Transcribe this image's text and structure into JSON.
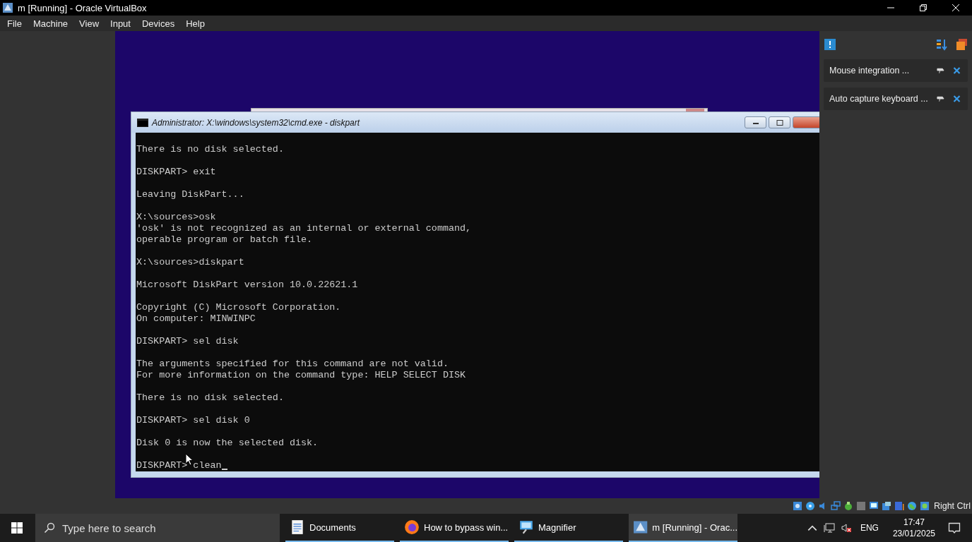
{
  "window": {
    "title": "m [Running] - Oracle VirtualBox"
  },
  "menu": [
    "File",
    "Machine",
    "View",
    "Input",
    "Devices",
    "Help"
  ],
  "console": {
    "title": "Administrator: X:\\windows\\system32\\cmd.exe - diskpart",
    "blocks": [
      [
        "There is no disk selected."
      ],
      [
        "DISKPART> exit"
      ],
      [
        "Leaving DiskPart..."
      ],
      [
        "X:\\sources>osk",
        "'osk' is not recognized as an internal or external command,",
        "operable program or batch file."
      ],
      [
        "X:\\sources>diskpart"
      ],
      [
        "Microsoft DiskPart version 10.0.22621.1"
      ],
      [
        "Copyright (C) Microsoft Corporation.",
        "On computer: MINWINPC"
      ],
      [
        "DISKPART> sel disk"
      ],
      [
        "The arguments specified for this command are not valid.",
        "For more information on the command type: HELP SELECT DISK"
      ],
      [
        "There is no disk selected."
      ],
      [
        "DISKPART> sel disk 0"
      ],
      [
        "Disk 0 is now the selected disk."
      ],
      [
        "DISKPART> clean"
      ]
    ]
  },
  "notifications": [
    {
      "text": "Mouse integration ..."
    },
    {
      "text": "Auto capture keyboard ..."
    }
  ],
  "status_bar": {
    "host_key": "Right Ctrl"
  },
  "taskbar": {
    "search": {
      "placeholder": "Type here to search"
    },
    "apps": [
      {
        "kind": "document",
        "label": "Documents",
        "selected": false
      },
      {
        "kind": "browser",
        "label": "How to bypass win...",
        "selected": false
      },
      {
        "kind": "magnifier",
        "label": "Magnifier",
        "selected": false
      },
      {
        "kind": "virtualbox",
        "label": "m [Running] - Orac...",
        "selected": true
      }
    ],
    "language": "ENG",
    "time": "17:47",
    "date": "23/01/2025"
  }
}
